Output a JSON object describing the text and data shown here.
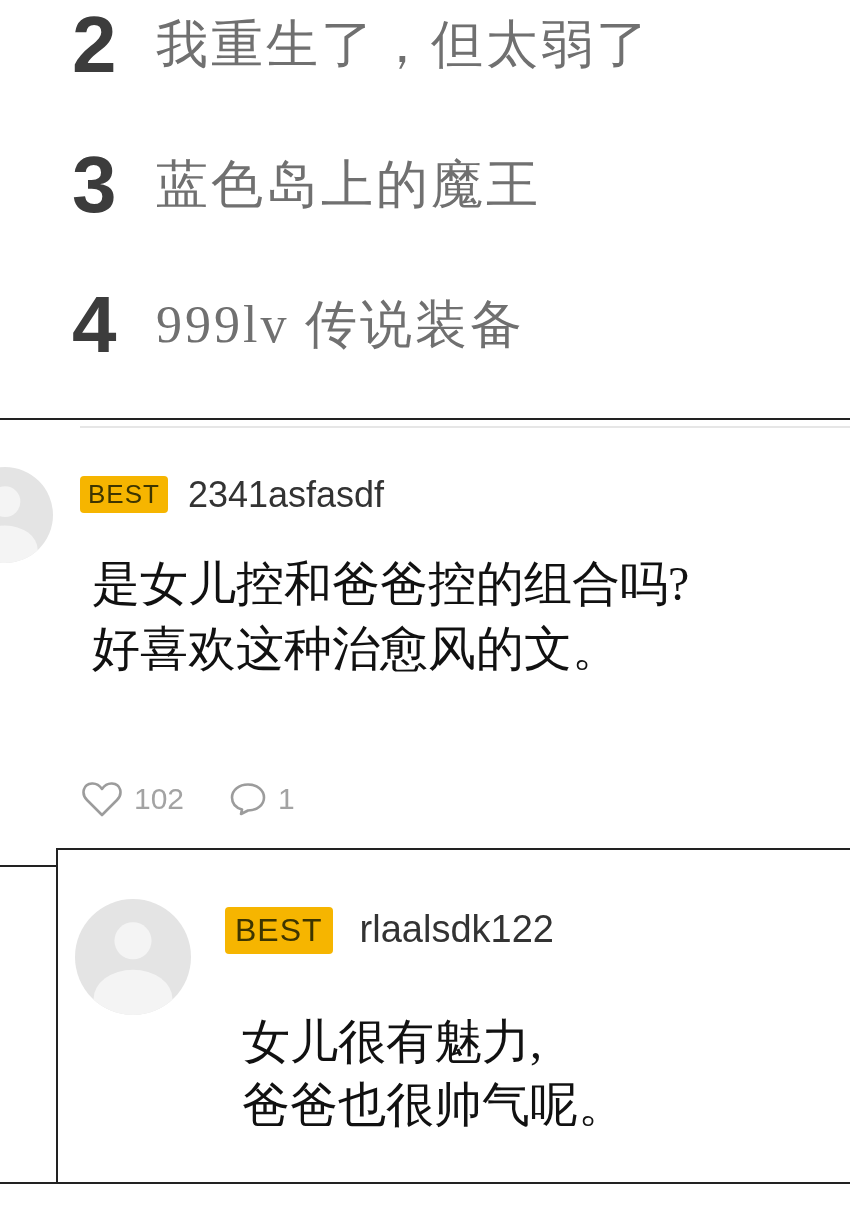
{
  "ranking": [
    {
      "rank": "2",
      "title": "我重生了，但太弱了"
    },
    {
      "rank": "3",
      "title": "蓝色岛上的魔王"
    },
    {
      "rank": "4",
      "title": "999lv 传说装备"
    }
  ],
  "comment": {
    "badge": "BEST",
    "username": "2341asfasdf",
    "text": "是女儿控和爸爸控的组合吗?\n好喜欢这种治愈风的文。",
    "likes": "102",
    "replies": "1"
  },
  "reply": {
    "badge": "BEST",
    "username": "rlaalsdk122",
    "text": "女儿很有魅力,\n爸爸也很帅气呢。"
  }
}
